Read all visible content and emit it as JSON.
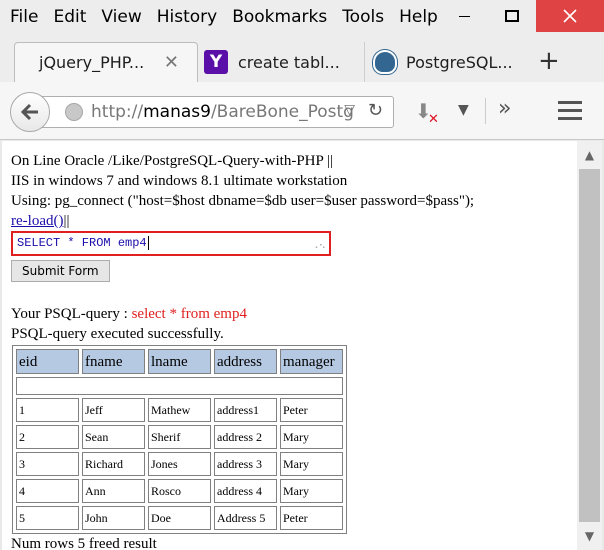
{
  "menu": [
    "File",
    "Edit",
    "View",
    "History",
    "Bookmarks",
    "Tools",
    "Help"
  ],
  "tabs": [
    {
      "label": "jQuery_PHP...",
      "icon": "none",
      "active": true
    },
    {
      "label": "create tabl...",
      "icon": "yahoo-icon"
    },
    {
      "label": "PostgreSQL...",
      "icon": "postgresql-elephant-icon"
    }
  ],
  "new_tab_label": "+",
  "nav": {
    "url_prefix": "http://",
    "url_host": "manas9",
    "url_path": "/BareBone_Postg"
  },
  "page": {
    "line1": "On Line Oracle /Like/PostgreSQL-Query-with-PHP ||",
    "line2": "IIS in windows 7 and windows 8.1 ultimate workstation",
    "line3": "Using: pg_connect (\"host=$host dbname=$db user=$user password=$pass\");",
    "reload_link": "re-load()",
    "reload_suffix": "||",
    "query_value": "SELECT * FROM emp4",
    "submit_label": "Submit Form",
    "psql_label": "Your PSQL-query : ",
    "psql_query": "select * from emp4",
    "success_msg": "PSQL-query executed successfully.",
    "footer_msg": "Num rows 5 freed result"
  },
  "table": {
    "headers": [
      "eid",
      "fname",
      "lname",
      "address",
      "manager"
    ],
    "rows": [
      [
        "1",
        "Jeff",
        "Mathew",
        "address1",
        "Peter"
      ],
      [
        "2",
        "Sean",
        "Sherif",
        "address 2",
        "Mary"
      ],
      [
        "3",
        "Richard",
        "Jones",
        "address 3",
        "Mary"
      ],
      [
        "4",
        "Ann",
        "Rosco",
        "address 4",
        "Mary"
      ],
      [
        "5",
        "John",
        "Doe",
        "Address 5",
        "Peter"
      ]
    ]
  },
  "colors": {
    "accent_red": "#e02020",
    "table_header_bg": "#b5c9e2",
    "link": "#1a0dab"
  }
}
